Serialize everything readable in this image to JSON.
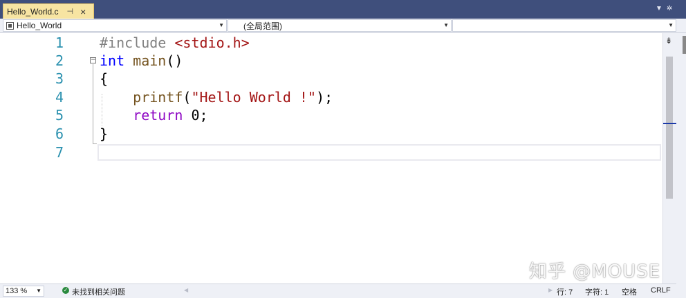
{
  "tab": {
    "title": "Hello_World.c",
    "pin_icon": "pin-icon",
    "close_icon": "close-icon"
  },
  "tab_toolbar": {
    "dropdown_icon": "chevron-down-icon",
    "settings_icon": "gear-icon"
  },
  "navbar": {
    "project": "Hello_World",
    "scope": "(全局范围)",
    "member": ""
  },
  "line_numbers": [
    "1",
    "2",
    "3",
    "4",
    "5",
    "6",
    "7"
  ],
  "code": {
    "line1_directive": "#include",
    "line1_header": "<stdio.h>",
    "line2_type": "int",
    "line2_name": "main",
    "line2_parens": "()",
    "line3": "{",
    "line4_func": "printf",
    "line4_open": "(",
    "line4_string": "\"Hello World !\"",
    "line4_close": ");",
    "line5_keyword": "return",
    "line5_value": "0",
    "line5_end": ";",
    "line6": "}"
  },
  "status": {
    "zoom": "133 %",
    "issues": "未找到相关问题",
    "line": "行: 7",
    "column": "字符: 1",
    "whitespace": "空格",
    "eol": "CRLF"
  },
  "watermark": "知乎 @MOUSE",
  "colors": {
    "tab_bg": "#f7e4a2",
    "titlebar": "#3f4f7c",
    "keyword": "#0000ff",
    "string": "#a31515",
    "function": "#74531f",
    "control": "#8f08c4",
    "line_number": "#2b91af"
  }
}
